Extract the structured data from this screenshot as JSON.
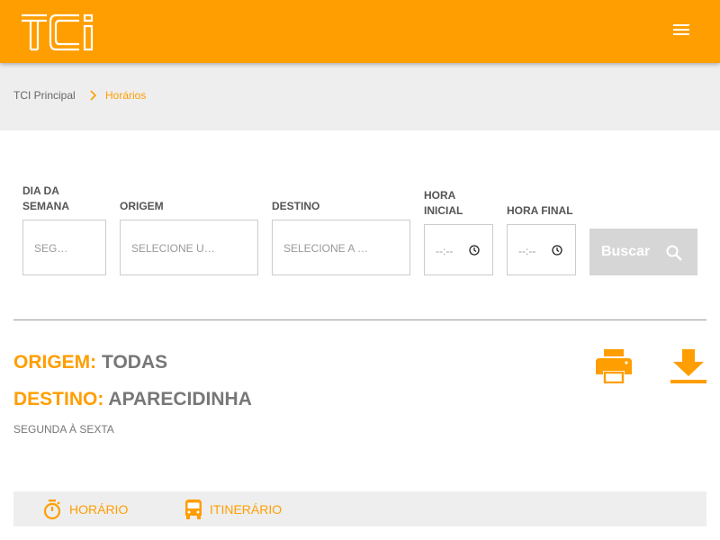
{
  "header": {
    "logo_text": "TCi",
    "menu_icon": "hamburger-menu-icon",
    "accent_color": "#ff9e00"
  },
  "breadcrumb": {
    "home": "TCI Principal",
    "current": "Horários"
  },
  "search_form": {
    "dia_label": "DIA DA SEMANA",
    "dia_value": "SEG…",
    "origem_label": "ORIGEM",
    "origem_placeholder": "SELECIONE U…",
    "destino_label": "DESTINO",
    "destino_placeholder": "SELECIONE A …",
    "hora_inicial_label": "HORA INICIAL",
    "hora_inicial_value": "--:--",
    "hora_final_label": "HORA FINAL",
    "hora_final_value": "--:--",
    "buscar_label": "Buscar"
  },
  "result": {
    "origem_key": "ORIGEM:",
    "origem_value": "TODAS",
    "destino_key": "DESTINO:",
    "destino_value": "APARECIDINHA",
    "days": "SEGUNDA À SEXTA"
  },
  "tabs": [
    {
      "label": "HORÁRIO",
      "icon": "stopwatch-icon"
    },
    {
      "label": "ITINERÁRIO",
      "icon": "bus-icon"
    }
  ]
}
